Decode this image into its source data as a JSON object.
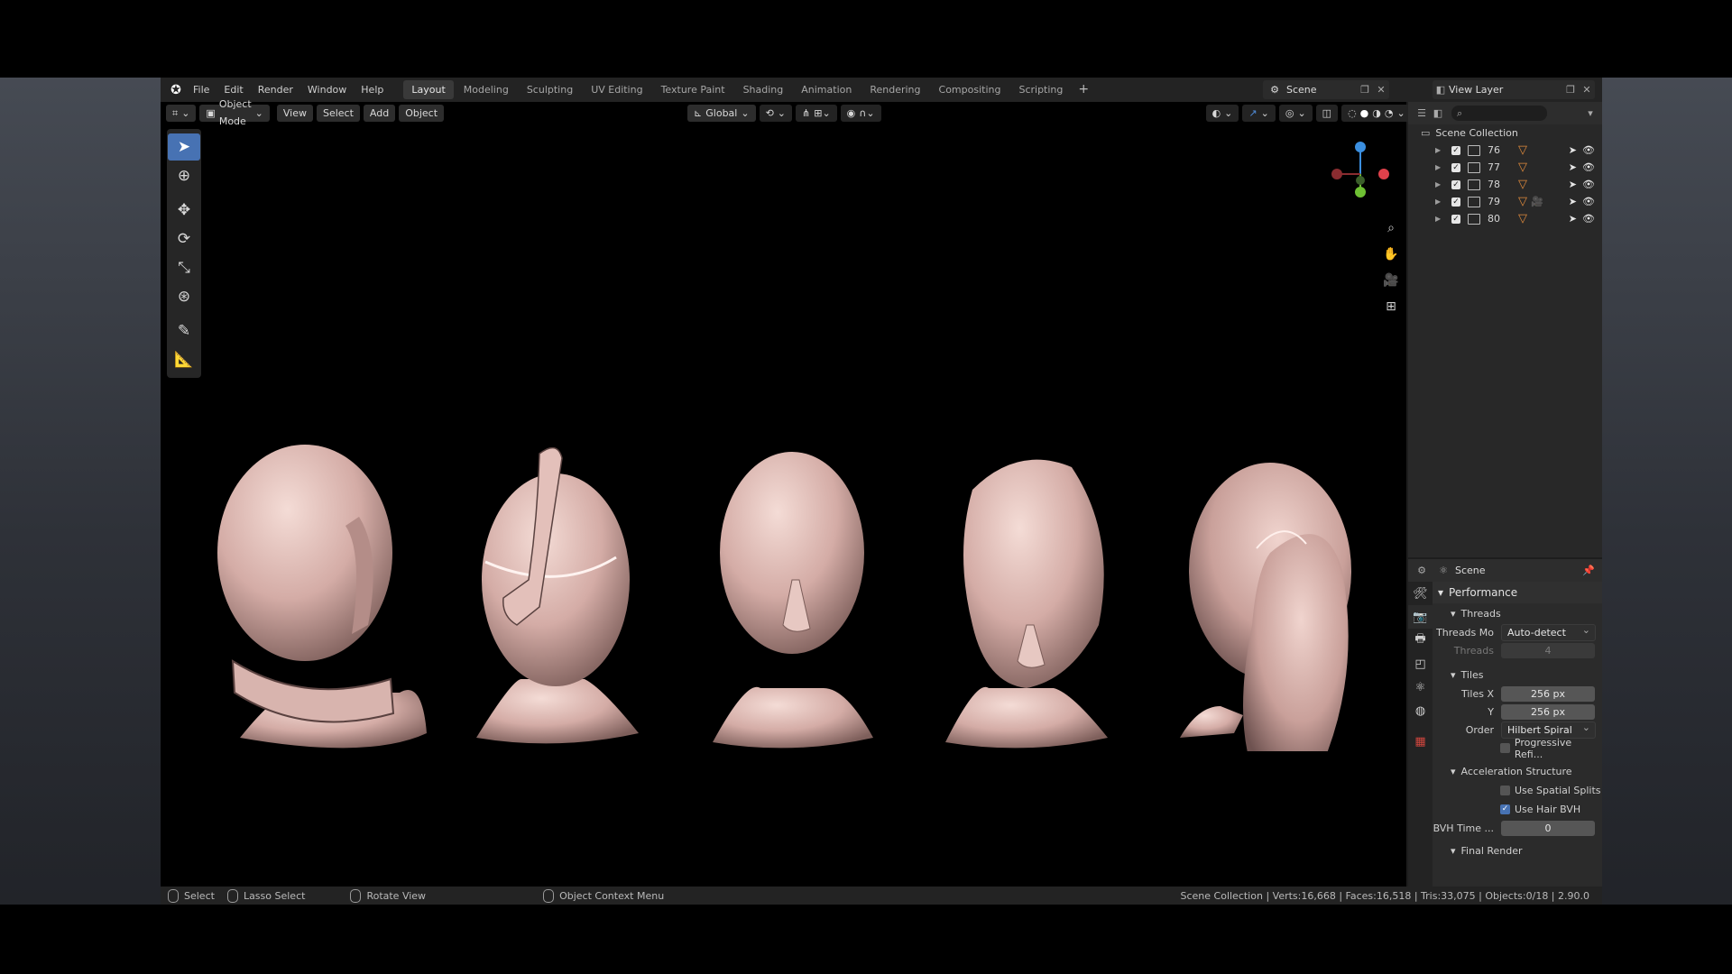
{
  "menubar": {
    "menus": [
      "File",
      "Edit",
      "Render",
      "Window",
      "Help"
    ],
    "tabs": [
      "Layout",
      "Modeling",
      "Sculpting",
      "UV Editing",
      "Texture Paint",
      "Shading",
      "Animation",
      "Rendering",
      "Compositing",
      "Scripting"
    ],
    "active_tab": "Layout",
    "scene_name": "Scene",
    "view_layer": "View Layer"
  },
  "viewport_header": {
    "mode": "Object Mode",
    "menus": [
      "View",
      "Select",
      "Add",
      "Object"
    ],
    "transform_orientation": "Global"
  },
  "navigation": {
    "gizmo_axes": {
      "x": "#e0414b",
      "y": "#6ec033",
      "z": "#3b8fe0"
    }
  },
  "tools": [
    "select-box",
    "cursor",
    "move",
    "rotate",
    "scale",
    "transform",
    "annotate",
    "measure"
  ],
  "outliner": {
    "root": "Scene Collection",
    "collections": [
      {
        "name": "76",
        "camera": false
      },
      {
        "name": "77",
        "camera": false
      },
      {
        "name": "78",
        "camera": false
      },
      {
        "name": "79",
        "camera": true
      },
      {
        "name": "80",
        "camera": false
      }
    ]
  },
  "properties": {
    "context": "Scene",
    "panel": "Performance",
    "threads": {
      "title": "Threads",
      "mode_label": "Threads Mo",
      "mode_value": "Auto-detect",
      "count_label": "Threads",
      "count_value": "4"
    },
    "tiles": {
      "title": "Tiles",
      "x_label": "Tiles X",
      "x_value": "256 px",
      "y_label": "Y",
      "y_value": "256 px",
      "order_label": "Order",
      "order_value": "Hilbert Spiral",
      "progressive_label": "Progressive Refi..."
    },
    "accel": {
      "title": "Acceleration Structure",
      "spatial_label": "Use Spatial Splits",
      "spatial_checked": false,
      "hair_label": "Use Hair BVH",
      "hair_checked": true,
      "bvh_label": "BVH Time ...",
      "bvh_value": "0"
    },
    "final_render": "Final Render"
  },
  "status": {
    "select": "Select",
    "lasso": "Lasso Select",
    "rotate": "Rotate View",
    "context_menu": "Object Context Menu",
    "stats": "Scene Collection | Verts:16,668 | Faces:16,518 | Tris:33,075 | Objects:0/18 | 2.90.0"
  },
  "colors": {
    "accent": "#4772b3",
    "mesh_icon": "#e08a3c",
    "skin": "#e6c6c0"
  }
}
